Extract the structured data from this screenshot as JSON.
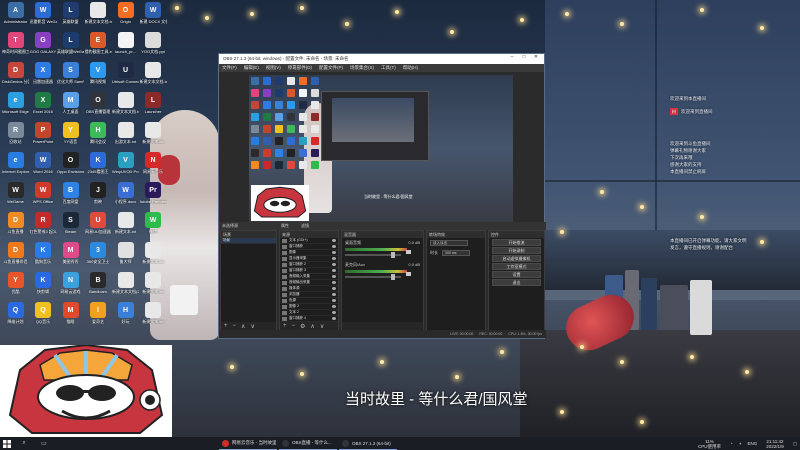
{
  "desktop_icons": [
    {
      "label": "Administrator",
      "color": "#3a6ea5",
      "glyph": "A"
    },
    {
      "label": "迅雷影音 WeGame",
      "color": "#2b6cd6",
      "glyph": "W"
    },
    {
      "label": "英雄联盟",
      "color": "#1f3b70",
      "glyph": "L"
    },
    {
      "label": "新建文本文档.txt",
      "color": "#e8e8e8",
      "glyph": ""
    },
    {
      "label": "Origin",
      "color": "#f26c22",
      "glyph": "O"
    },
    {
      "label": "新建 DOCX 文档.docx",
      "color": "#2f5fae",
      "glyph": "W"
    },
    {
      "label": "神奇时间截图工具",
      "color": "#e0457b",
      "glyph": "T"
    },
    {
      "label": "GOG GALAXY",
      "color": "#8a3fc2",
      "glyph": "G"
    },
    {
      "label": "英雄联盟WeGame版",
      "color": "#1d3c6e",
      "glyph": "L"
    },
    {
      "label": "猎豹截图工具.exe",
      "color": "#d85a2a",
      "glyph": "E"
    },
    {
      "label": "launch_pr...",
      "color": "#f4f4f4",
      "glyph": ""
    },
    {
      "label": "YOO文档.ppt",
      "color": "#dcdcdc",
      "glyph": ""
    },
    {
      "label": "DiskGenius 分区工具",
      "color": "#c8453b",
      "glyph": "D"
    },
    {
      "label": "迅雷加速器",
      "color": "#2e7be6",
      "glyph": "X"
    },
    {
      "label": "优化大师 SamPro软件",
      "color": "#3a80d8",
      "glyph": "S"
    },
    {
      "label": "腾讯视频",
      "color": "#2a9af0",
      "glyph": "V"
    },
    {
      "label": "Ubisoft Connect",
      "color": "#1f2a44",
      "glyph": "U"
    },
    {
      "label": "新建文本文档.txt",
      "color": "#e8e8e8",
      "glyph": ""
    },
    {
      "label": "Microsoft Edge",
      "color": "#2aa0e0",
      "glyph": "e"
    },
    {
      "label": "Excel 2016",
      "color": "#1f7a44",
      "glyph": "X"
    },
    {
      "label": "人工桌面",
      "color": "#5aa0e8",
      "glyph": "M"
    },
    {
      "label": "OBS直播管理",
      "color": "#30343a",
      "glyph": "O"
    },
    {
      "label": "新建文本文档.txt",
      "color": "#e8e8e8",
      "glyph": ""
    },
    {
      "label": "Launcher",
      "color": "#8c2a2a",
      "glyph": "L"
    },
    {
      "label": "回收站",
      "color": "#7a8a9a",
      "glyph": "R"
    },
    {
      "label": "PowerPoint",
      "color": "#c4462a",
      "glyph": "P"
    },
    {
      "label": "YY语音",
      "color": "#f0c020",
      "glyph": "Y"
    },
    {
      "label": "腾讯会议",
      "color": "#3dbb5a",
      "glyph": "H"
    },
    {
      "label": "出游文本.txt",
      "color": "#e8e8e8",
      "glyph": ""
    },
    {
      "label": "新建文本.txt",
      "color": "#e8e8e8",
      "glyph": ""
    },
    {
      "label": "Internet Explorer",
      "color": "#2a7de0",
      "glyph": "e"
    },
    {
      "label": "Word 2016",
      "color": "#2f5fae",
      "glyph": "W"
    },
    {
      "label": "Oppo Envisioner",
      "color": "#222222",
      "glyph": "O"
    },
    {
      "label": "2345看图王",
      "color": "#2e6bd8",
      "glyph": "K"
    },
    {
      "label": "WinyUVOD Pro",
      "color": "#2aa0c0",
      "glyph": "V"
    },
    {
      "label": "网易云音乐",
      "color": "#d42a2a",
      "glyph": "N"
    },
    {
      "label": "WeGame",
      "color": "#2a2a2a",
      "glyph": "W"
    },
    {
      "label": "WPS Office",
      "color": "#d03a2a",
      "glyph": "W"
    },
    {
      "label": "百度网盘",
      "color": "#2e82e6",
      "glyph": "B"
    },
    {
      "label": "剪映",
      "color": "#222222",
      "glyph": "J"
    },
    {
      "label": "小程序.docx",
      "color": "#3a6ed6",
      "glyph": "W"
    },
    {
      "label": "Adobe Premiere",
      "color": "#2a1a5a",
      "glyph": "Pr"
    },
    {
      "label": "斗鱼直播",
      "color": "#f28a22",
      "glyph": "D"
    },
    {
      "label": "红色警戒3 起义时刻",
      "color": "#c42a2a",
      "glyph": "R"
    },
    {
      "label": "Steam",
      "color": "#1b2838",
      "glyph": "S"
    },
    {
      "label": "网易UU加速器",
      "color": "#e04a3a",
      "glyph": "U"
    },
    {
      "label": "新建文本.txt",
      "color": "#e8e8e8",
      "glyph": ""
    },
    {
      "label": "微信",
      "color": "#2dbb4a",
      "glyph": "W"
    },
    {
      "label": "斗鱼直播伴侣",
      "color": "#f07a1a",
      "glyph": "D"
    },
    {
      "label": "酷狗音乐",
      "color": "#2a7ae8",
      "glyph": "K"
    },
    {
      "label": "美图秀秀",
      "color": "#e04a8a",
      "glyph": "M"
    },
    {
      "label": "360安全卫士",
      "color": "#2a8ae0",
      "glyph": "3"
    },
    {
      "label": "鲁大师",
      "color": "#e0e0e0",
      "glyph": ""
    },
    {
      "label": "新建文本.txt",
      "color": "#e8e8e8",
      "glyph": ""
    },
    {
      "label": "优酷",
      "color": "#e8552a",
      "glyph": "Y"
    },
    {
      "label": "快剪辑",
      "color": "#2a6ae0",
      "glyph": "K"
    },
    {
      "label": "网易云游戏",
      "color": "#3aa0e0",
      "glyph": "N"
    },
    {
      "label": "Bandicam",
      "color": "#2a2a2a",
      "glyph": "B"
    },
    {
      "label": "新建文本文档(2).txt",
      "color": "#e8e8e8",
      "glyph": ""
    },
    {
      "label": "新建文本.txt",
      "color": "#e8e8e8",
      "glyph": ""
    },
    {
      "label": "降维计划",
      "color": "#2a6ae0",
      "glyph": "Q"
    },
    {
      "label": "QQ音乐",
      "color": "#f0c020",
      "glyph": "Q"
    },
    {
      "label": "猫眼",
      "color": "#e04a2a",
      "glyph": "M"
    },
    {
      "label": "爱奇艺",
      "color": "#f2a020",
      "glyph": "I"
    },
    {
      "label": "好玩",
      "color": "#3a80d8",
      "glyph": "H"
    },
    {
      "label": "新建文本.txt",
      "color": "#e8e8e8",
      "glyph": ""
    }
  ],
  "obs": {
    "title": "OBS 27.1.3 (64-bit, windows) - 配置文件: 未命名 - 场景: 未命名",
    "menu": [
      "文件(F)",
      "编辑(E)",
      "视图(V)",
      "停靠部件(D)",
      "配置文件(P)",
      "场景集合(S)",
      "工具(T)",
      "帮助(H)"
    ],
    "preview_caption": "当时故里 - 等什么君/国风堂",
    "dock_labels": [
      "未选择源",
      "属性",
      "滤镜"
    ],
    "panels": {
      "scenes": "场景",
      "sources": "来源",
      "mixer": "混音器",
      "transitions": "转场特效",
      "controls": "控件"
    },
    "sources_list": [
      "文本 (GDI+)",
      "窗口捕获",
      "图像",
      "显示器采集",
      "窗口捕获 2",
      "窗口捕获 3",
      "音频输入采集",
      "音频输出采集",
      "媒体源",
      "浏览器",
      "色源",
      "图像 2",
      "文本 2",
      "窗口捕获 4"
    ],
    "mixer": [
      {
        "name": "桌面音频",
        "db": "0.0 dB"
      },
      {
        "name": "麦克风/Aux",
        "db": "0.0 dB"
      }
    ],
    "transitions": {
      "type": "淡入淡出",
      "duration_label": "时长",
      "duration": "300 ms"
    },
    "controls": [
      "开始推流",
      "开始录制",
      "启动虚拟摄像机",
      "工作室模式",
      "设置",
      "退出"
    ],
    "status": [
      "LIVE: 00:00:00",
      "REC: 00:00:00",
      "CPU: 1.6%, 30.00 fps"
    ]
  },
  "right_overlay": {
    "line1": "欢迎来到本直播间",
    "badge1": "粉",
    "line2": "欢迎来到直播间",
    "line3": [
      "欢迎来到斗鱼直播间",
      "弹幕礼物谢谢大家",
      "下次再来哦",
      "感谢大家的支持",
      "本直播间禁止刷屏"
    ],
    "line4": [
      "本直播间已开启弹幕功能，请大家文明",
      "发言，遵守直播规则，谢谢配合"
    ]
  },
  "subtitle": "当时故里 - 等什么君/国风堂",
  "taskbar": {
    "tasks": [
      {
        "label": "网易云音乐 - 当时故里",
        "color": "#d42a2a"
      },
      {
        "label": "OBS直播 - 等什么...",
        "color": "#30343a"
      },
      {
        "label": "OBS 27.1.3 (64-bit)",
        "color": "#30343a"
      }
    ],
    "tray": {
      "cpu": "11%",
      "cpu_label": "CPU使用率",
      "lang": "ENG",
      "time": "21:11:42",
      "date": "2022/1/9"
    }
  },
  "colors": {
    "accent": "#7aa0d8",
    "obs_bg": "#2b2b2b",
    "badge_red": "#e2343c",
    "badge_green": "#3ba55a"
  }
}
